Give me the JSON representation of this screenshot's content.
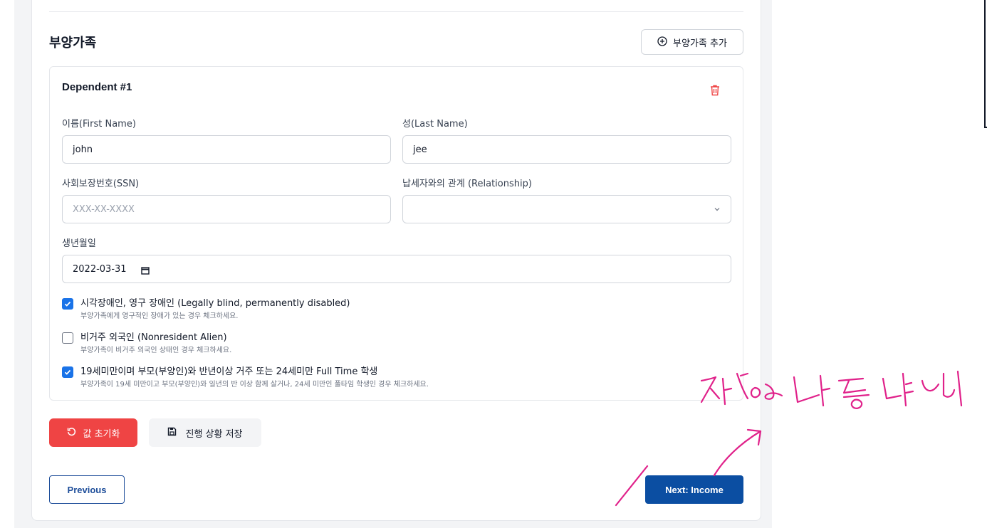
{
  "section": {
    "title": "부양가족",
    "add_button_label": "부양가족 추가",
    "add_icon": "plus-circle-icon"
  },
  "dependent": {
    "title": "Dependent #1",
    "delete_icon": "trash-icon",
    "first_name_label": "이름(First Name)",
    "first_name_value": "john",
    "last_name_label": "성(Last Name)",
    "last_name_value": "jee",
    "ssn_label": "사회보장번호(SSN)",
    "ssn_placeholder": "XXX-XX-XXXX",
    "relationship_label": "납세자와의 관계 (Relationship)",
    "relationship_value": "",
    "dob_label": "생년월일",
    "dob_value": "2022-03-31",
    "checkboxes": [
      {
        "checked": true,
        "label": "시각장애인, 영구 장애인 (Legally blind, permanently disabled)",
        "help": "부양가족에게 영구적인 장애가 있는 경우 체크하세요."
      },
      {
        "checked": false,
        "label": "비거주 외국인 (Nonresident Alien)",
        "help": "부양가족이 비거주 외국인 상태인 경우 체크하세요."
      },
      {
        "checked": true,
        "label": "19세미만이며 부모(부양인)와 반년이상 거주 또는 24세미만 Full Time 학생",
        "help": "부양가족이 19세 미만이고 부모(부양인)와 일년의 반 이상 함께 살거나, 24세 미만인 풀타임 학생인 경우 체크하세요."
      }
    ]
  },
  "actions": {
    "reset_label": "값 초기화",
    "save_label": "진행 상황 저장",
    "previous_label": "Previous",
    "next_label": "Next: Income"
  },
  "colors": {
    "accent": "#0b4ea2",
    "danger": "#ef4444",
    "checkbox": "#1a73e8",
    "annotation": "#e0218a"
  }
}
